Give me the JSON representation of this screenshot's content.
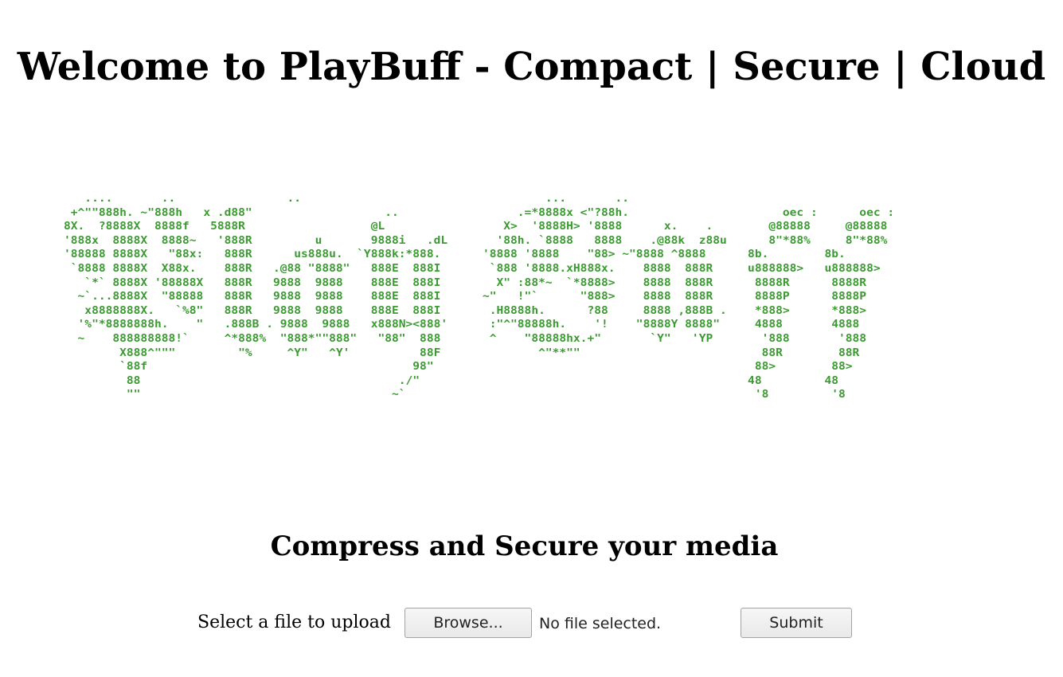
{
  "header": {
    "title": "Welcome to PlayBuff - Compact | Secure | Cloud"
  },
  "logo": {
    "ascii_art": "   ....       ..                ..                                   ...       ..\n +^\"\"888h. ~\"888h   x .d88\"                   ..                 .=*8888x <\"?88h.                      oec :      oec :\n8X.  ?8888X  8888f   5888R                  @L                 X>  '8888H> '8888      x.    .        @88888     @88888\n'888x  8888X  8888~   '888R         u       9888i   .dL       '88h. `8888   8888    .@88k  z88u      8\"*88%     8\"*88%\n'88888 8888X   \"88x:   888R      us888u.  `Y888k:*888.      '8888 '8888    \"88> ~\"8888 ^8888      8b.        8b.\n `8888 8888X  X88x.    888R   .@88 \"8888\"   888E  888I       `888 '8888.xH888x.    8888  888R     u888888>   u888888>\n   `*` 8888X '88888X   888R   9888  9888    888E  888I        X\" :88*~  `*8888>    8888  888R      8888R      8888R\n  ~`...8888X  \"88888   888R   9888  9888    888E  888I      ~\"   !\"`      \"888>    8888  888R      8888P      8888P\n   x8888888X.   `%8\"   888R   9888  9888    888E  888I       .H8888h.      ?88     8888 ,888B .    *888>      *888>\n  '%\"*8888888h.    \"   .888B . 9888  9888   x888N><888'      :\"^\"88888h.    '!    \"8888Y 8888\"     4888       4888\n  ~    888888888!`     ^*888%  \"888*\"\"888\"   \"88\"  888       ^    \"88888hx.+\"       `Y\"   'YP       '888       '888\n        X888^\"\"\"         \"%     ^Y\"   ^Y'          88F              ^\"**\"\"                          88R        88R\n        `88f                                      98\"                                              88>        88>\n         88                                     ./\"                                               48         48\n         \"\"                                    ~`                                                  '8         '8",
    "color": "#3c9a32"
  },
  "main": {
    "subtitle": "Compress and Secure your media"
  },
  "upload": {
    "label": "Select a file to upload",
    "browse_label": "Browse...",
    "file_status": "No file selected.",
    "submit_label": "Submit"
  }
}
